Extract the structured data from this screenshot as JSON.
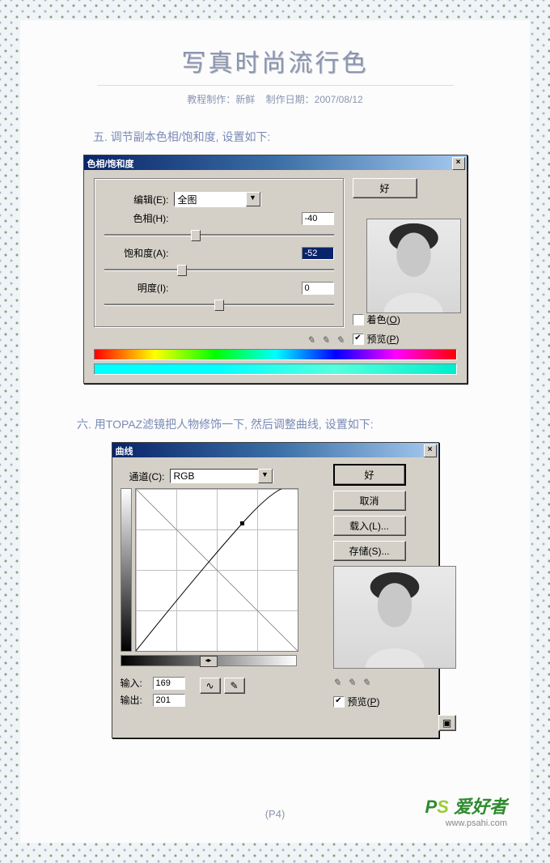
{
  "header": {
    "title": "写真时尚流行色",
    "meta_author_label": "教程制作：",
    "meta_author": "新鲜",
    "meta_date_label": "制作日期：",
    "meta_date": "2007/08/12"
  },
  "step5": {
    "text": "五. 调节副本色相/饱和度, 设置如下:",
    "dialog_title": "色相/饱和度",
    "edit_label": "编辑(E):",
    "edit_value": "全图",
    "hue_label": "色相(H):",
    "hue_value": "-40",
    "sat_label": "饱和度(A):",
    "sat_value": "-52",
    "light_label": "明度(I):",
    "light_value": "0",
    "ok": "好",
    "colorize": "着色(O)",
    "preview": "预览(P)"
  },
  "step6": {
    "text": "六. 用TOPAZ滤镜把人物修饰一下, 然后调整曲线, 设置如下:",
    "dialog_title": "曲线",
    "channel_label": "通道(C):",
    "channel_value": "RGB",
    "ok": "好",
    "cancel": "取消",
    "load": "载入(L)...",
    "save": "存储(S)...",
    "input_label": "输入:",
    "input_value": "169",
    "output_label": "输出:",
    "output_value": "201",
    "preview": "预览(P)"
  },
  "footer": {
    "page": "(P4)",
    "wm1": "P",
    "wm2": "S",
    "wm3": "爱好者",
    "wm_sub": "www.psahi.com"
  }
}
